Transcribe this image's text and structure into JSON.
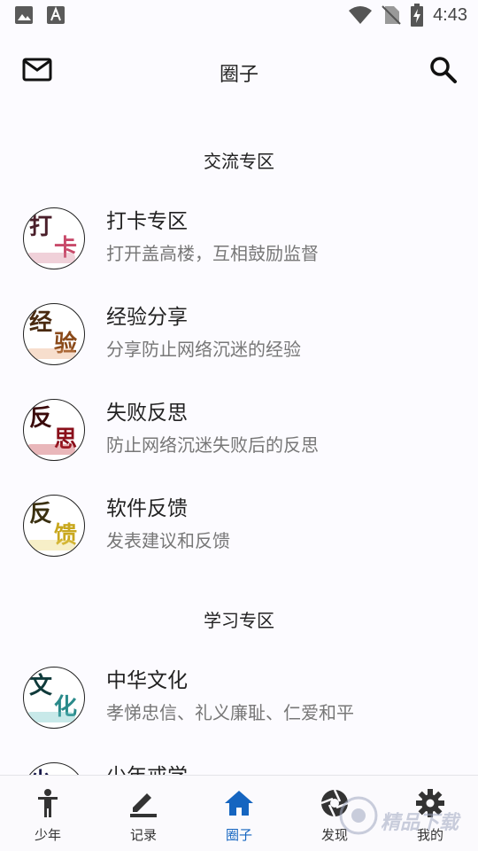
{
  "status_bar": {
    "time": "4:43",
    "icons": [
      "image-icon",
      "text-a-icon",
      "wifi-icon",
      "no-sim-icon",
      "battery-charging-icon"
    ]
  },
  "app_bar": {
    "title": "圈子",
    "left_icon": "mail-icon",
    "right_icon": "search-icon"
  },
  "sections": [
    {
      "title": "交流专区",
      "items": [
        {
          "title": "打卡专区",
          "subtitle": "打开盖高楼，互相鼓励监督",
          "avatar_chars": [
            "打",
            "卡"
          ],
          "avatar_colors": [
            "#4a1f2a",
            "#c84a6a"
          ]
        },
        {
          "title": "经验分享",
          "subtitle": "分享防止网络沉迷的经验",
          "avatar_chars": [
            "经",
            "验"
          ],
          "avatar_colors": [
            "#4a2a10",
            "#8a4a1a"
          ]
        },
        {
          "title": "失败反思",
          "subtitle": "防止网络沉迷失败后的反思",
          "avatar_chars": [
            "反",
            "思"
          ],
          "avatar_colors": [
            "#3a0a0a",
            "#8a0f1a"
          ]
        },
        {
          "title": "软件反馈",
          "subtitle": "发表建议和反馈",
          "avatar_chars": [
            "反",
            "馈"
          ],
          "avatar_colors": [
            "#3a3010",
            "#c9a81e"
          ]
        }
      ]
    },
    {
      "title": "学习专区",
      "items": [
        {
          "title": "中华文化",
          "subtitle": "孝悌忠信、礼义廉耻、仁爱和平",
          "avatar_chars": [
            "文",
            "化"
          ],
          "avatar_colors": [
            "#0f3a3a",
            "#2a8a8a"
          ]
        },
        {
          "title": "少年戒学",
          "subtitle": "",
          "avatar_chars": [
            "少",
            ""
          ],
          "avatar_colors": [
            "#1a1a4a",
            "#3a3a8a"
          ]
        }
      ]
    }
  ],
  "bottom_nav": {
    "active_color": "#1565c0",
    "items": [
      {
        "label": "少年",
        "icon": "person-icon",
        "active": false
      },
      {
        "label": "记录",
        "icon": "pen-icon",
        "active": false
      },
      {
        "label": "圈子",
        "icon": "home-icon",
        "active": true
      },
      {
        "label": "发现",
        "icon": "aperture-icon",
        "active": false
      },
      {
        "label": "我的",
        "icon": "gear-icon",
        "active": false
      }
    ]
  },
  "watermark": {
    "text": "精品下载"
  }
}
